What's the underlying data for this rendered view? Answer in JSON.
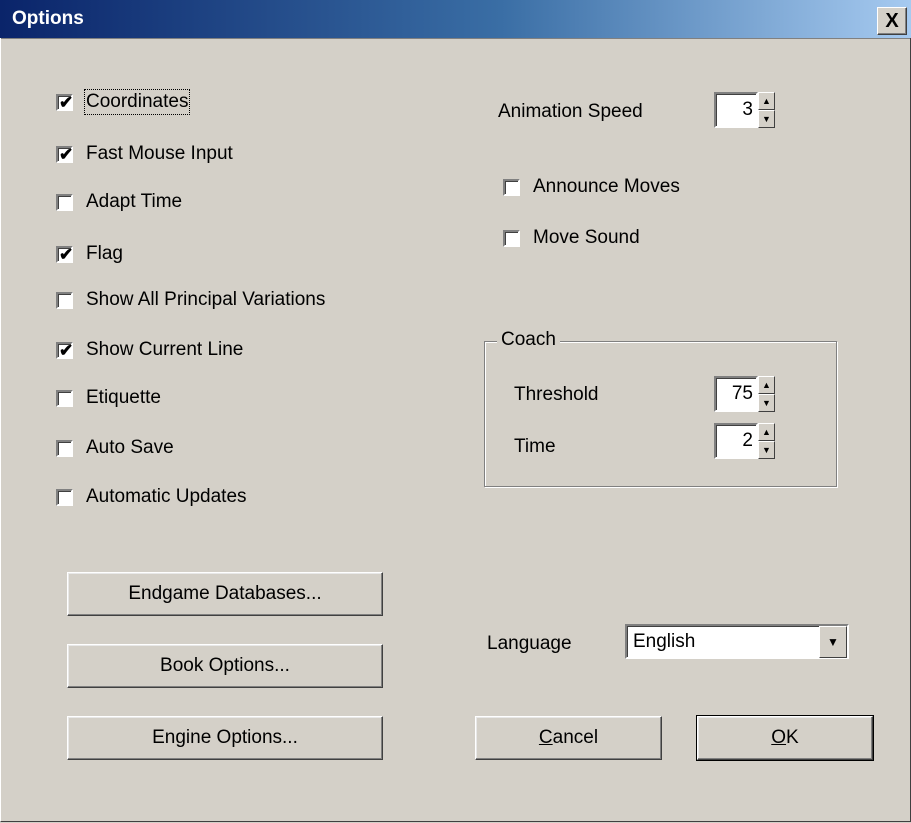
{
  "window": {
    "title": "Options",
    "close_glyph": "X"
  },
  "checkboxes": [
    {
      "label": "Coordinates",
      "checked": true
    },
    {
      "label": "Fast Mouse Input",
      "checked": true
    },
    {
      "label": "Adapt Time",
      "checked": false
    },
    {
      "label": "Flag",
      "checked": true
    },
    {
      "label": "Show All Principal Variations",
      "checked": false
    },
    {
      "label": "Show Current Line",
      "checked": true
    },
    {
      "label": "Etiquette",
      "checked": false
    },
    {
      "label": "Auto Save",
      "checked": false
    },
    {
      "label": "Automatic Updates",
      "checked": false
    }
  ],
  "animation": {
    "label": "Animation Speed",
    "value": "3"
  },
  "sound": [
    {
      "label": "Announce Moves",
      "checked": false
    },
    {
      "label": "Move Sound",
      "checked": false
    }
  ],
  "coach": {
    "title": "Coach",
    "threshold_label": "Threshold",
    "threshold_value": "75",
    "time_label": "Time",
    "time_value": "2"
  },
  "buttons": {
    "endgame": "Endgame Databases...",
    "book": "Book Options...",
    "engine": "Engine Options...",
    "cancel": "Cancel",
    "ok": "OK"
  },
  "language": {
    "label": "Language",
    "value": "English"
  }
}
